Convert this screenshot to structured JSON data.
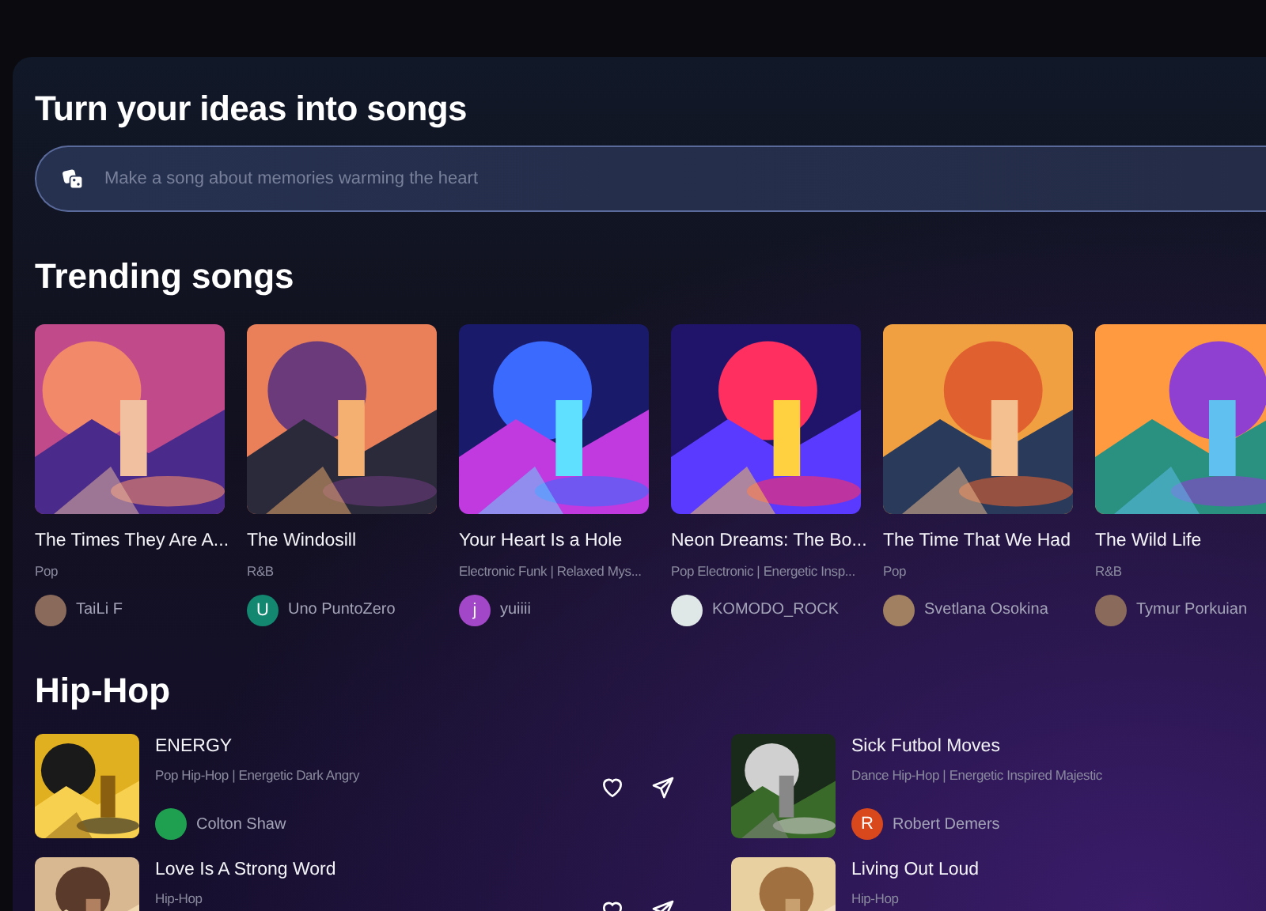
{
  "hero": {
    "title": "Turn your ideas into songs",
    "prompt": {
      "placeholder": "Make a song about memories warming the heart"
    }
  },
  "trending": {
    "title": "Trending songs",
    "songs": [
      {
        "title": "The Times They Are A...",
        "genre": "Pop",
        "artist": "TaiLi F"
      },
      {
        "title": "The Windosill",
        "genre": "R&B",
        "artist": "Uno PuntoZero",
        "avatar": {
          "kind": "initial",
          "initial": "U",
          "color": "#13876f"
        }
      },
      {
        "title": "Your Heart Is a Hole",
        "genre": "Electronic Funk | Relaxed Mys...",
        "artist": "yuiiii",
        "avatar": {
          "kind": "initial",
          "initial": "j",
          "color": "#a347c9"
        }
      },
      {
        "title": "Neon Dreams: The Bo...",
        "genre": "Pop Electronic | Energetic Insp...",
        "artist": "KOMODO_ROCK"
      },
      {
        "title": "The Time That We Had",
        "genre": "Pop",
        "artist": "Svetlana Osokina"
      },
      {
        "title": "The Wild Life",
        "genre": "R&B",
        "artist": "Tymur Porkuian"
      }
    ]
  },
  "section": {
    "title": "Hip-Hop",
    "songs": [
      {
        "title": "ENERGY",
        "genre": "Pop Hip-Hop | Energetic Dark Angry",
        "artist": "Colton Shaw",
        "actions": true
      },
      {
        "title": "Sick Futbol Moves",
        "genre": "Dance Hip-Hop | Energetic Inspired Majestic",
        "artist": "Robert Demers",
        "avatar": {
          "kind": "initial",
          "initial": "R",
          "color": "#d9481c"
        },
        "actions": false
      },
      {
        "title": "Love Is A Strong Word",
        "genre": "Hip-Hop",
        "actions": true
      },
      {
        "title": "Living Out Loud",
        "genre": "Hip-Hop",
        "actions": false
      }
    ]
  }
}
